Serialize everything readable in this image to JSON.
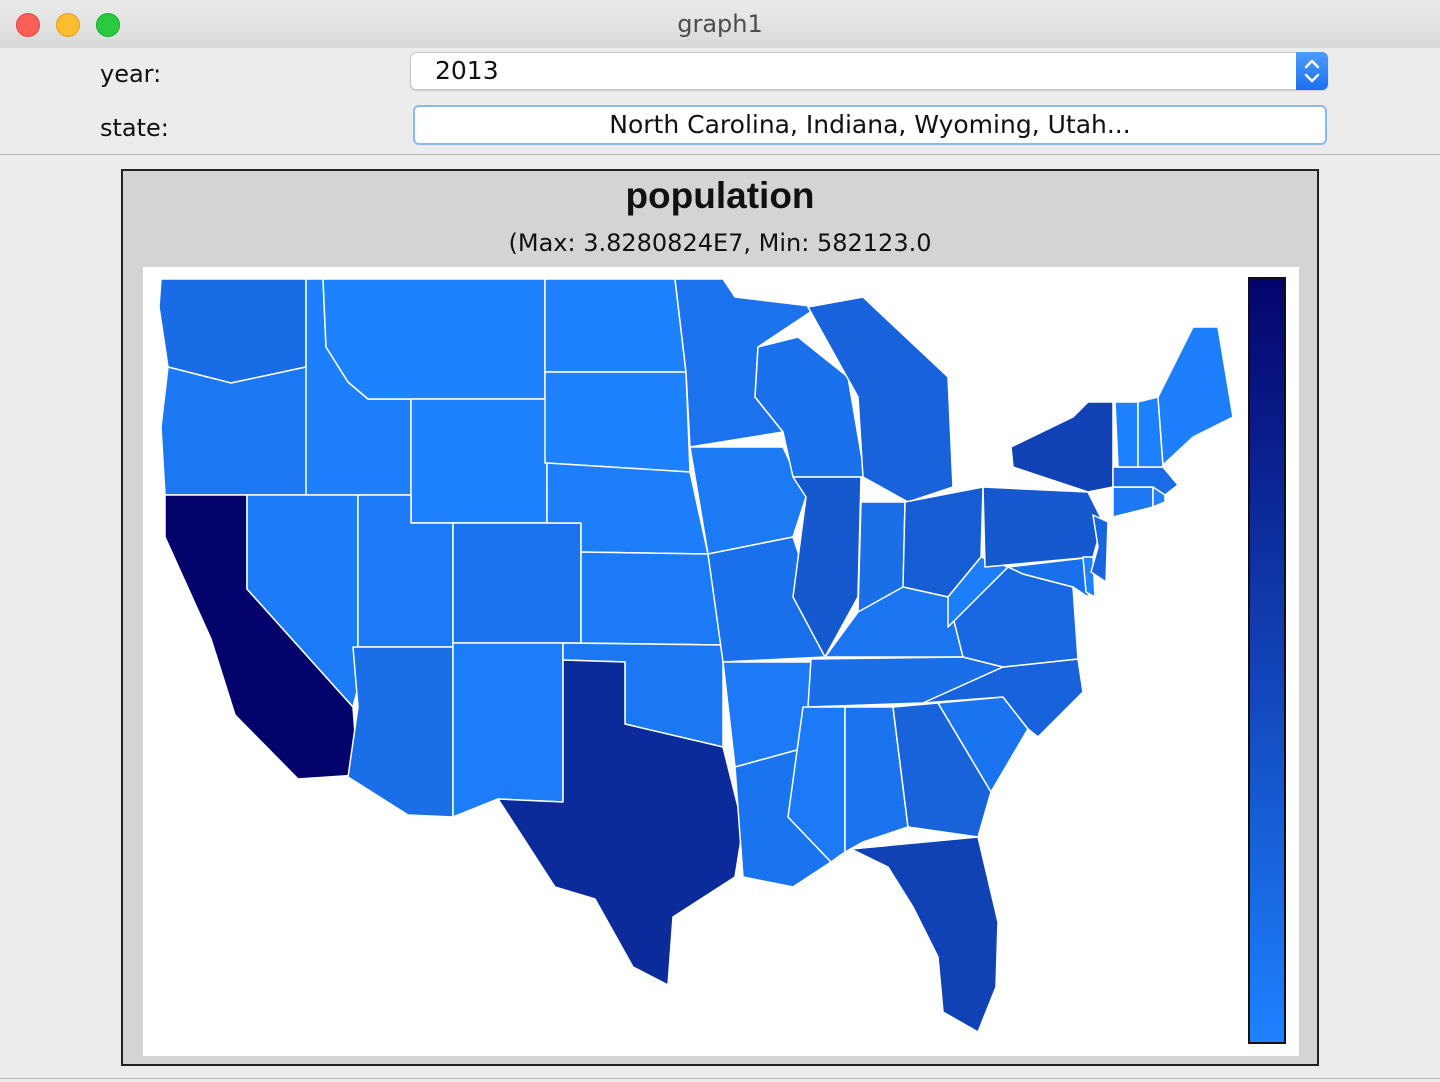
{
  "window": {
    "title": "graph1"
  },
  "controls": {
    "year_label": "year:",
    "year_value": "2013",
    "state_label": "state:",
    "state_value": "North Carolina, Indiana, Wyoming, Utah..."
  },
  "chart": {
    "title": "population",
    "subtitle": "(Max: 3.8280824E7, Min: 582123.0"
  },
  "colors": {
    "low": "#1e82ff",
    "high": "#04036c",
    "state_border": "#ffffff"
  },
  "chart_data": {
    "type": "choropleth",
    "title": "population",
    "subtitle": "(Max: 3.8280824E7, Min: 582123.0",
    "metric": "population",
    "year": 2013,
    "max": 38280824.0,
    "min": 582123.0,
    "legend": "colorbar, right, vertical (light blue = min, dark navy = max)",
    "states": [
      {
        "name": "Washington",
        "value": 6970000
      },
      {
        "name": "Oregon",
        "value": 3930000
      },
      {
        "name": "California",
        "value": 38280824
      },
      {
        "name": "Idaho",
        "value": 1610000
      },
      {
        "name": "Nevada",
        "value": 2790000
      },
      {
        "name": "Montana",
        "value": 1015000
      },
      {
        "name": "Wyoming",
        "value": 582123
      },
      {
        "name": "Utah",
        "value": 2900000
      },
      {
        "name": "Arizona",
        "value": 6630000
      },
      {
        "name": "Colorado",
        "value": 5270000
      },
      {
        "name": "New Mexico",
        "value": 2085000
      },
      {
        "name": "North Dakota",
        "value": 723000
      },
      {
        "name": "South Dakota",
        "value": 845000
      },
      {
        "name": "Nebraska",
        "value": 1870000
      },
      {
        "name": "Kansas",
        "value": 2890000
      },
      {
        "name": "Oklahoma",
        "value": 3850000
      },
      {
        "name": "Texas",
        "value": 26450000
      },
      {
        "name": "Minnesota",
        "value": 5420000
      },
      {
        "name": "Iowa",
        "value": 3090000
      },
      {
        "name": "Missouri",
        "value": 6040000
      },
      {
        "name": "Arkansas",
        "value": 2960000
      },
      {
        "name": "Louisiana",
        "value": 4630000
      },
      {
        "name": "Wisconsin",
        "value": 5740000
      },
      {
        "name": "Illinois",
        "value": 12880000
      },
      {
        "name": "Michigan",
        "value": 9900000
      },
      {
        "name": "Indiana",
        "value": 6570000
      },
      {
        "name": "Ohio",
        "value": 11570000
      },
      {
        "name": "Kentucky",
        "value": 4400000
      },
      {
        "name": "Tennessee",
        "value": 6500000
      },
      {
        "name": "Mississippi",
        "value": 2990000
      },
      {
        "name": "Alabama",
        "value": 4830000
      },
      {
        "name": "Georgia",
        "value": 9990000
      },
      {
        "name": "Florida",
        "value": 19550000
      },
      {
        "name": "South Carolina",
        "value": 4770000
      },
      {
        "name": "North Carolina",
        "value": 9850000
      },
      {
        "name": "Virginia",
        "value": 8260000
      },
      {
        "name": "West Virginia",
        "value": 1850000
      },
      {
        "name": "Pennsylvania",
        "value": 12770000
      },
      {
        "name": "New York",
        "value": 19650000
      },
      {
        "name": "Maryland",
        "value": 5930000
      },
      {
        "name": "Delaware",
        "value": 925000
      },
      {
        "name": "New Jersey",
        "value": 8900000
      },
      {
        "name": "Connecticut",
        "value": 3600000
      },
      {
        "name": "Rhode Island",
        "value": 1050000
      },
      {
        "name": "Massachusetts",
        "value": 6690000
      },
      {
        "name": "Vermont",
        "value": 626000
      },
      {
        "name": "New Hampshire",
        "value": 1320000
      },
      {
        "name": "Maine",
        "value": 1330000
      }
    ]
  }
}
